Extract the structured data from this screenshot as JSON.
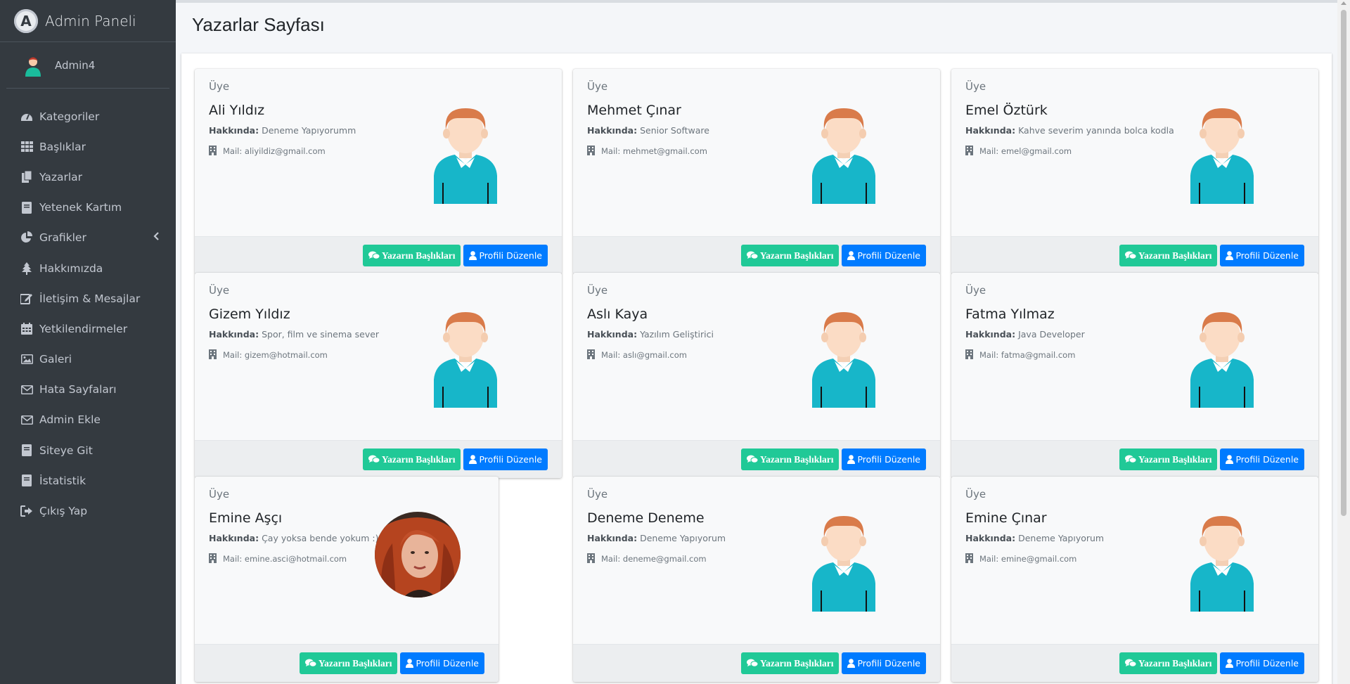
{
  "brand": {
    "title": "Admin Paneli",
    "logo_letter": "A"
  },
  "user": {
    "name": "Admin4"
  },
  "sidebar": {
    "items": [
      {
        "label": "Kategoriler",
        "icon": "gauge-icon"
      },
      {
        "label": "Başlıklar",
        "icon": "grid-icon"
      },
      {
        "label": "Yazarlar",
        "icon": "copy-icon"
      },
      {
        "label": "Yetenek Kartım",
        "icon": "book-icon"
      },
      {
        "label": "Grafikler",
        "icon": "pie-chart-icon"
      },
      {
        "label": "Hakkımızda",
        "icon": "tree-icon"
      },
      {
        "label": "İletişim & Mesajlar",
        "icon": "edit-icon"
      },
      {
        "label": "Yetkilendirmeler",
        "icon": "calendar-icon"
      },
      {
        "label": "Galeri",
        "icon": "image-icon"
      },
      {
        "label": "Hata Sayfaları",
        "icon": "envelope-icon"
      },
      {
        "label": "Admin Ekle",
        "icon": "envelope-icon"
      },
      {
        "label": "Siteye Git",
        "icon": "book-icon"
      },
      {
        "label": "İstatistik",
        "icon": "book-icon"
      },
      {
        "label": "Çıkış Yap",
        "icon": "sign-out-icon"
      }
    ]
  },
  "page": {
    "title": "Yazarlar Sayfası"
  },
  "labels": {
    "role": "Üye",
    "about": "Hakkında:",
    "mail_prefix": "Mail:",
    "btn_titles": "Yazarın Başlıkları",
    "btn_edit": "Profili Düzenle"
  },
  "authors": [
    {
      "name": "Ali Yıldız",
      "about": "Deneme Yapıyorumm",
      "mail": "aliyildiz@gmail.com"
    },
    {
      "name": "Mehmet Çınar",
      "about": "Senior Software",
      "mail": "mehmet@gmail.com"
    },
    {
      "name": "Emel Öztürk",
      "about": "Kahve severim yanında bolca kodla",
      "mail": "emel@gmail.com"
    },
    {
      "name": "Gizem Yıldız",
      "about": "Spor, film ve sinema sever",
      "mail": "gizem@hotmail.com"
    },
    {
      "name": "Aslı Kaya",
      "about": "Yazılım Geliştirici",
      "mail": "aslı@gmail.com"
    },
    {
      "name": "Fatma Yılmaz",
      "about": "Java Developer",
      "mail": "fatma@gmail.com"
    },
    {
      "name": "Emine Aşçı",
      "about": "Çay yoksa bende yokum :)",
      "mail": "emine.asci@hotmail.com"
    },
    {
      "name": "Deneme Deneme",
      "about": "Deneme Yapıyorum",
      "mail": "deneme@gmail.com"
    },
    {
      "name": "Emine Çınar",
      "about": "Deneme Yapıyorum",
      "mail": "emine@gmail.com"
    }
  ]
}
